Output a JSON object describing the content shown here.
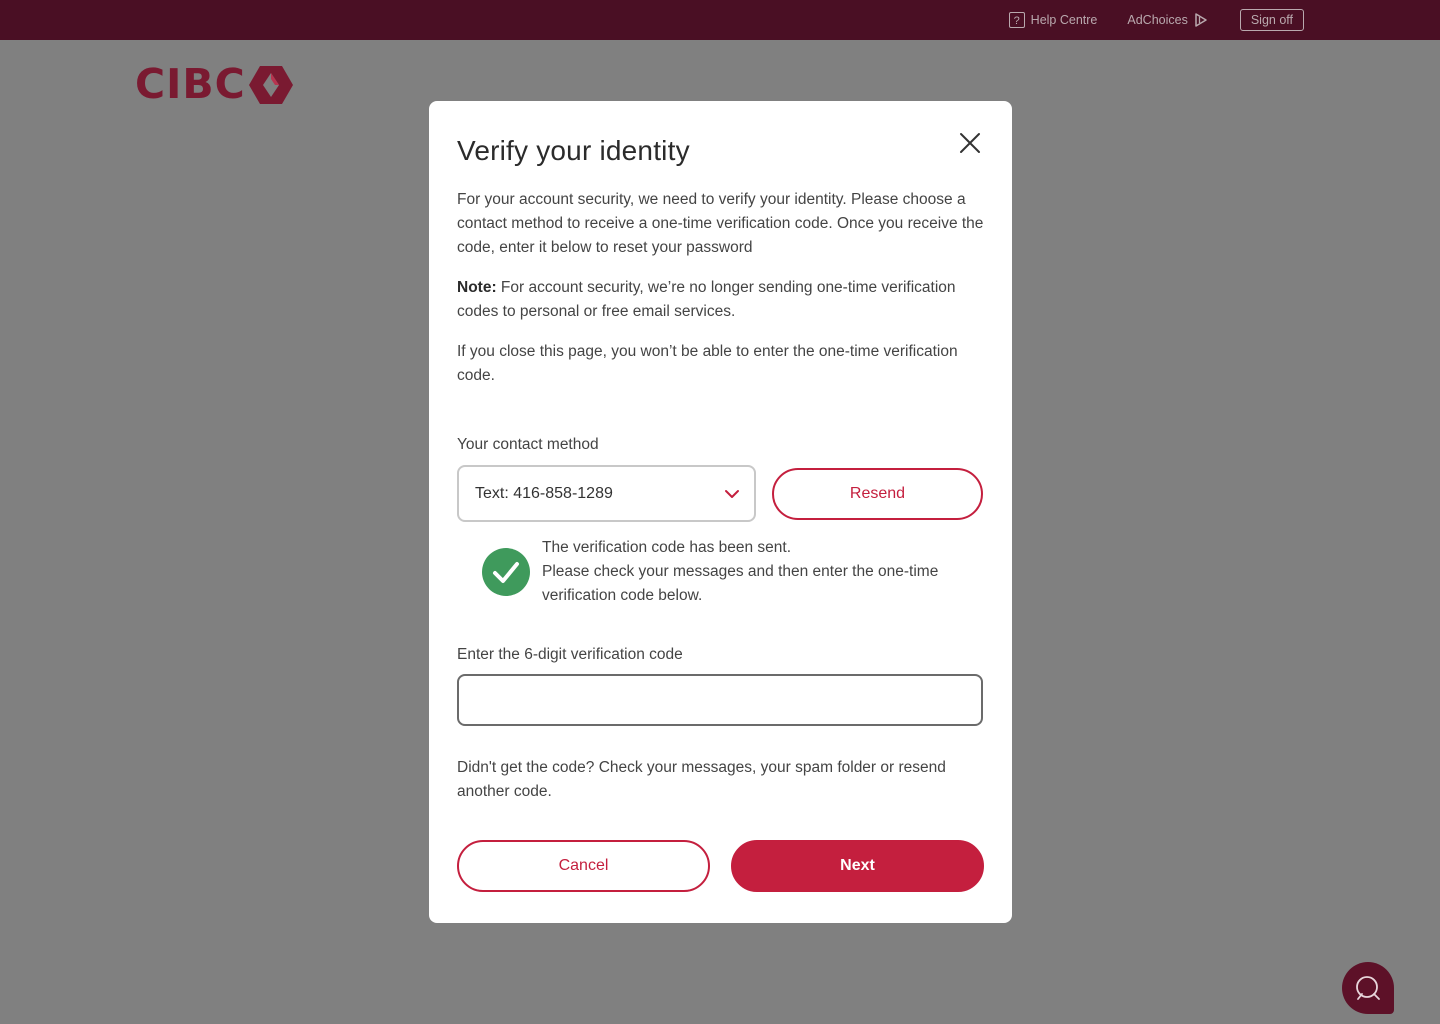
{
  "topbar": {
    "help_label": "Help Centre",
    "adchoices_label": "AdChoices",
    "signoff_label": "Sign off"
  },
  "brand": {
    "name": "CIBC",
    "color": "#7a1a31"
  },
  "modal": {
    "title": "Verify your identity",
    "intro": "For your account security, we need to verify your identity. Please choose a contact method to receive a one-time verification code. Once you receive the code, enter it below to reset your password",
    "note_label": "Note:",
    "note_text": " For account security, we’re no longer sending one-time verification codes to personal or free email services.",
    "close_warning": "If you close this page, you won’t be able to enter the one-time verification code.",
    "contact_label": "Your contact method",
    "contact_selected": "Text: 416-858-1289",
    "resend_label": "Resend",
    "success_line1": "The verification code has been sent.",
    "success_line2": "Please check your messages and then enter the one-time verification code below.",
    "code_label": "Enter the 6-digit verification code",
    "code_value": "",
    "help_text": "Didn't get the code? Check your messages, your spam folder or resend another code.",
    "cancel_label": "Cancel",
    "next_label": "Next"
  },
  "colors": {
    "topbar": "#4a0f24",
    "accent": "#c41f3e",
    "success": "#3f9a5c",
    "overlay": "#808080"
  },
  "icons": {
    "help": "help-icon",
    "adchoices": "adchoices-icon",
    "close": "close-icon",
    "chevron": "chevron-down-icon",
    "check": "check-circle-icon",
    "chat": "chat-icon"
  }
}
